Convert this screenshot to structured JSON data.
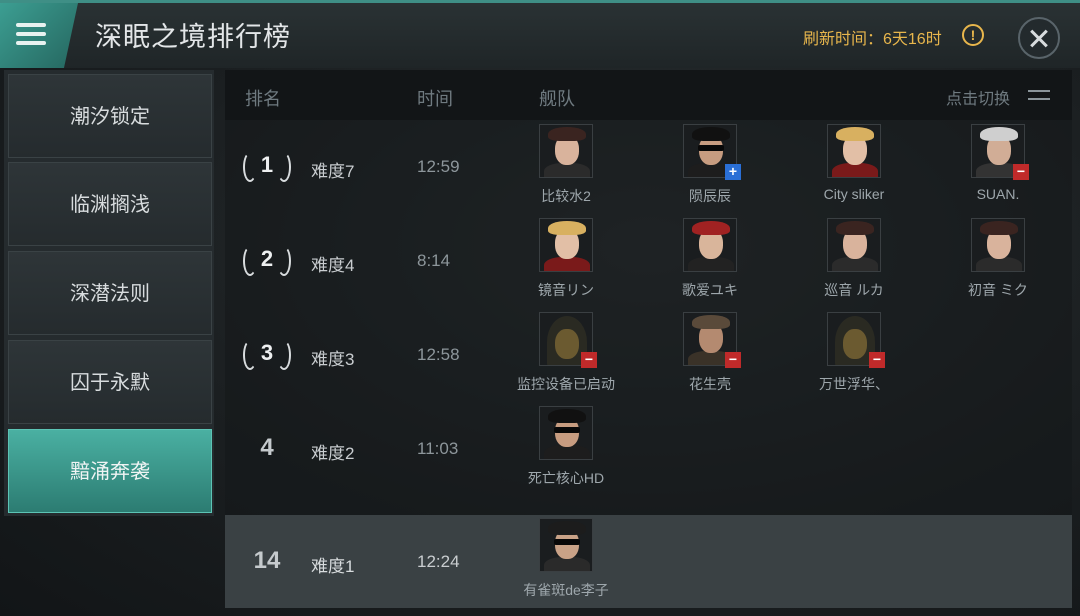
{
  "header": {
    "title": "深眠之境排行榜",
    "refresh_label": "刷新时间：6天16时",
    "warn_glyph": "!"
  },
  "sidebar": {
    "items": [
      {
        "label": "潮汐锁定"
      },
      {
        "label": "临渊搁浅"
      },
      {
        "label": "深潜法则"
      },
      {
        "label": "囚于永默"
      },
      {
        "label": "黯涌奔袭"
      }
    ],
    "active_index": 4
  },
  "table": {
    "col_rank": "排名",
    "col_time": "时间",
    "col_fleet": "舰队",
    "switch_label": "点击切换",
    "rows": [
      {
        "rank": "1",
        "difficulty": "难度7",
        "time": "12:59",
        "members": [
          {
            "name": "比较水2",
            "badge": "",
            "look": "dark-hair-female"
          },
          {
            "name": "陨辰辰",
            "badge": "+",
            "look": "sunglasses-male"
          },
          {
            "name": "City sliker",
            "badge": "",
            "look": "blonde-female"
          },
          {
            "name": "SUAN.",
            "badge": "−",
            "look": "white-hair-male"
          }
        ]
      },
      {
        "rank": "2",
        "difficulty": "难度4",
        "time": "8:14",
        "members": [
          {
            "name": "镜音リン",
            "badge": "",
            "look": "blonde-female"
          },
          {
            "name": "歌爱ユキ",
            "badge": "",
            "look": "cap-female"
          },
          {
            "name": "巡音 ルカ",
            "badge": "",
            "look": "dark-hair-female"
          },
          {
            "name": "初音 ミク",
            "badge": "",
            "look": "dark-hair-female"
          }
        ]
      },
      {
        "rank": "3",
        "difficulty": "难度3",
        "time": "12:58",
        "members": [
          {
            "name": "监控设备已启动",
            "badge": "−",
            "look": "hood"
          },
          {
            "name": "花生壳",
            "badge": "−",
            "look": "cap-male"
          },
          {
            "name": "万世浮华、",
            "badge": "−",
            "look": "hood"
          }
        ]
      },
      {
        "rank": "4",
        "difficulty": "难度2",
        "time": "11:03",
        "members": [
          {
            "name": "死亡核心HD",
            "badge": "",
            "look": "sunglasses-male"
          }
        ]
      }
    ],
    "my_row": {
      "rank": "14",
      "difficulty": "难度1",
      "time": "12:24",
      "members": [
        {
          "name": "有雀斑de李子",
          "badge": "",
          "look": "glasses-male"
        }
      ]
    }
  }
}
